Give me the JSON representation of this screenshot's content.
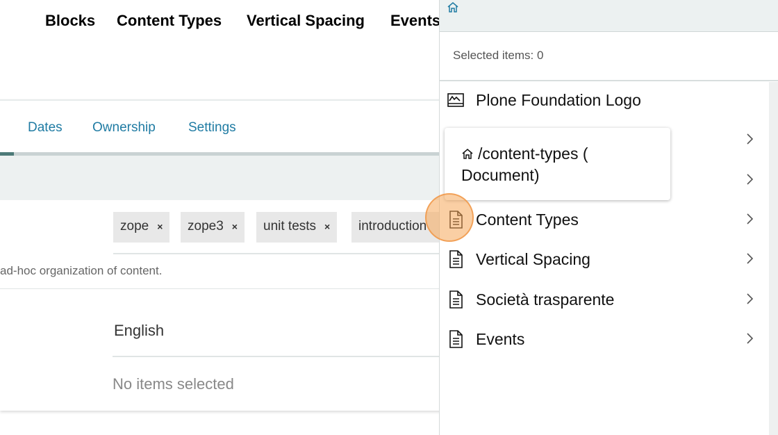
{
  "topnav": {
    "items": [
      "Blocks",
      "Content Types",
      "Vertical Spacing",
      "Events"
    ]
  },
  "tabs": [
    "Dates",
    "Ownership",
    "Settings"
  ],
  "tags": [
    {
      "label": "zope",
      "remove": "×"
    },
    {
      "label": "zope3",
      "remove": "×"
    },
    {
      "label": "unit tests",
      "remove": "×"
    },
    {
      "label": "introduction"
    }
  ],
  "help_text": "ad-hoc organization of content.",
  "language": "English",
  "related_items": "No items selected",
  "panel": {
    "selected": "Selected items: 0",
    "items": [
      {
        "label": "Plone Foundation Logo",
        "icon": "image-icon",
        "chevron": false
      },
      {
        "label": "",
        "icon": "document-icon",
        "chevron": true
      },
      {
        "label": "",
        "icon": "document-icon",
        "chevron": true
      },
      {
        "label": "Content Types",
        "icon": "document-icon",
        "chevron": true
      },
      {
        "label": "Vertical Spacing",
        "icon": "document-icon",
        "chevron": true
      },
      {
        "label": "Società trasparente",
        "icon": "document-icon",
        "chevron": true
      },
      {
        "label": "Events",
        "icon": "document-icon",
        "chevron": true
      }
    ]
  },
  "tooltip": {
    "text": "/content-types ( Document)",
    "icon": "home-icon"
  },
  "colors": {
    "link": "#1f7ba3",
    "highlight": "#f6a85a"
  }
}
